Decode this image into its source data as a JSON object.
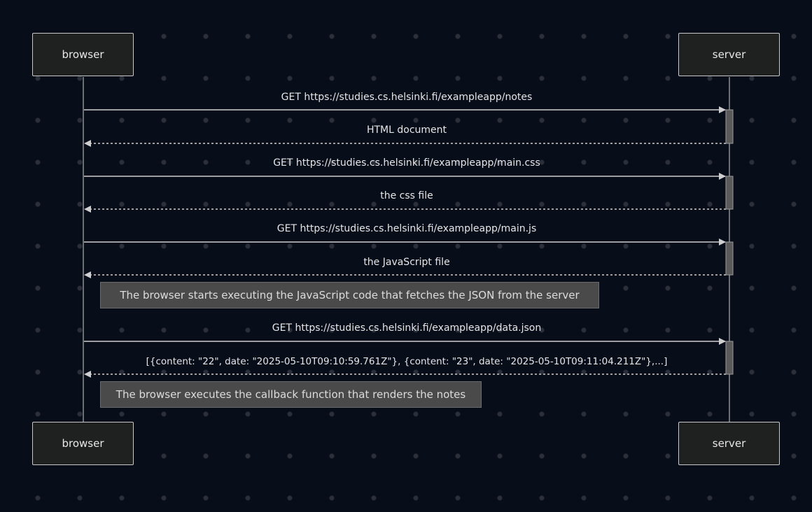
{
  "participants": {
    "left": "browser",
    "right": "server"
  },
  "messages": [
    {
      "text": "GET https://studies.cs.helsinki.fi/exampleapp/notes",
      "direction": "request"
    },
    {
      "text": "HTML document",
      "direction": "response"
    },
    {
      "text": "GET https://studies.cs.helsinki.fi/exampleapp/main.css",
      "direction": "request"
    },
    {
      "text": "the css file",
      "direction": "response"
    },
    {
      "text": "GET https://studies.cs.helsinki.fi/exampleapp/main.js",
      "direction": "request"
    },
    {
      "text": "the JavaScript file",
      "direction": "response"
    },
    {
      "text": "GET https://studies.cs.helsinki.fi/exampleapp/data.json",
      "direction": "request"
    },
    {
      "text": "[{content: \"22\", date: \"2025-05-10T09:10:59.761Z\"}, {content: \"23\", date: \"2025-05-10T09:11:04.211Z\"},...]",
      "direction": "response"
    }
  ],
  "notes": [
    "The browser starts executing the JavaScript code that fetches the JSON from the server",
    "The browser executes the callback function that renders the notes"
  ],
  "colors": {
    "background": "#080d1a",
    "line": "#cfcfcf",
    "actor_fill": "#1f2020",
    "note_fill": "#4a4a4a",
    "activation_fill": "#5a5a5a"
  }
}
